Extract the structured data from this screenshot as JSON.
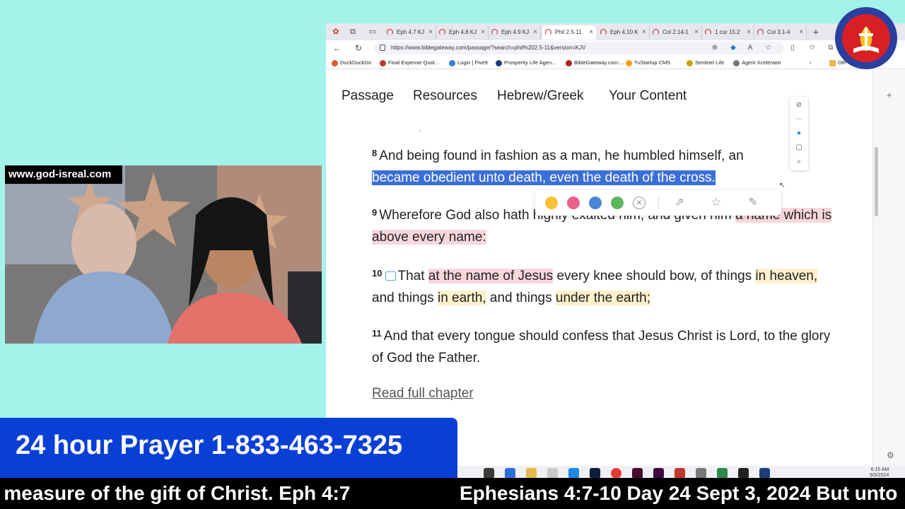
{
  "browser": {
    "tabs": [
      {
        "label": "Eph 4.7 KJ"
      },
      {
        "label": "Eph 4.8 KJ"
      },
      {
        "label": "Eph 4.9 KJ"
      },
      {
        "label": "Phil 2.5-11"
      },
      {
        "label": "Eph 4.10 K"
      },
      {
        "label": "Col 2.14-1"
      },
      {
        "label": "1 cor 15.2"
      },
      {
        "label": "Col 3.1-4"
      }
    ],
    "url": "https://www.biblegateway.com/passage/?search=phil%202.5-11&version=KJV",
    "bookmarks": [
      {
        "label": "DuckDuckGo",
        "color": "#de5833"
      },
      {
        "label": "Final Expense Quot...",
        "color": "#c0392b"
      },
      {
        "label": "Login | Five9",
        "color": "#3a7bd5"
      },
      {
        "label": "Prosperity Life Agen...",
        "color": "#1f3d7a"
      },
      {
        "label": "BibleGateway.com:...",
        "color": "#b22222"
      },
      {
        "label": "TvStartup CMS",
        "color": "#f39c12"
      },
      {
        "label": "Sentinel Life",
        "color": "#c8a000"
      },
      {
        "label": "Agent Xcelerator",
        "color": "#777777"
      }
    ],
    "bookmark_overflow": "Oth"
  },
  "site_nav": {
    "items": [
      "Passage",
      "Resources",
      "Hebrew/Greek",
      "Your Content"
    ]
  },
  "passage": {
    "partial_top": "·",
    "v8": {
      "num": "8",
      "text_a": "And being found in fashion as a man, he humbled himself, an",
      "text_highlighted": "became obedient unto death, even the death of the cross."
    },
    "v9": {
      "num": "9",
      "text_a": "Wherefore God also hath highly exalted him, and given him",
      "text_pink": "a name which is above every name:"
    },
    "v10": {
      "num": "10",
      "text_a": "That",
      "pink_1": "at the name of Jesus",
      "text_b": "every knee should bow, of things",
      "yellow_1": "in heaven,",
      "text_c": "and things",
      "yellow_2": "in earth,",
      "text_d": "and things",
      "yellow_3": "under the earth;"
    },
    "v11": {
      "num": "11",
      "text": "And that every tongue should confess that Jesus Christ is Lord, to the glory of God the Father."
    },
    "read_full": "Read full chapter"
  },
  "highlight_toolbar": {
    "colors": [
      "#f7c233",
      "#e8628a",
      "#4a86d8",
      "#5cb85c"
    ]
  },
  "clock": {
    "time": "6:15 AM",
    "date": "9/3/2024"
  },
  "logo": {
    "text": "GOD IS REAL"
  },
  "overlay": {
    "site_label": "www.god-isreal.com",
    "prayer_line": "24 hour Prayer 1-833-463-7325",
    "ticker_left": "e measure of the gift of Christ. Eph 4:7",
    "ticker_right": "Ephesians 4:7-10 Day 24 Sept 3, 2024 But unto"
  }
}
